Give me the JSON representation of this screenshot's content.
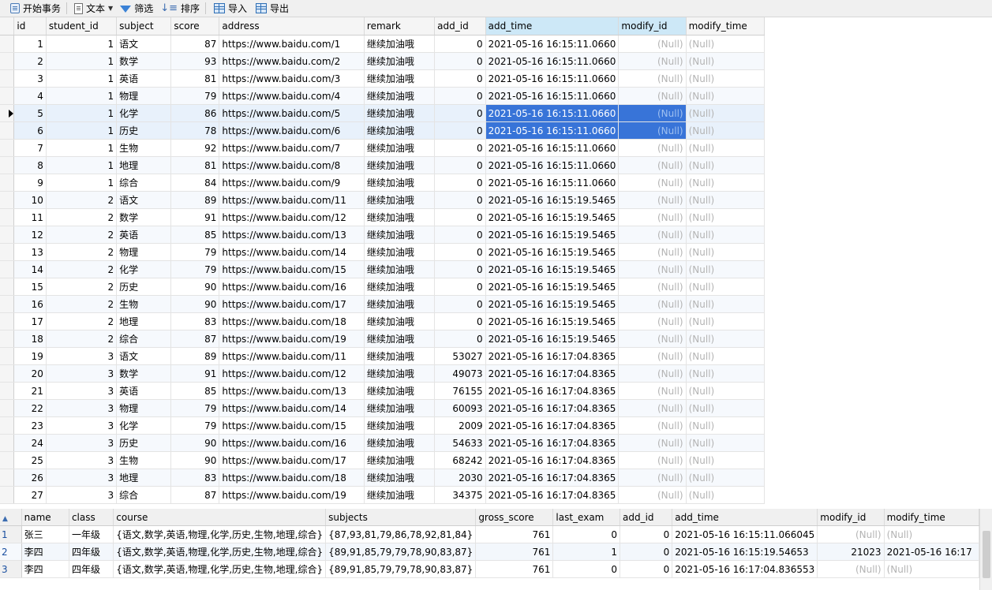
{
  "toolbar": {
    "begin_transaction": "开始事务",
    "text": "文本",
    "filter": "筛选",
    "sort": "排序",
    "import": "导入",
    "export": "导出"
  },
  "grid1": {
    "columns": [
      "id",
      "student_id",
      "subject",
      "score",
      "address",
      "remark",
      "add_id",
      "add_time",
      "modify_id",
      "modify_time"
    ],
    "rows": [
      [
        "1",
        "1",
        "语文",
        "87",
        "https://www.baidu.com/1",
        "继续加油哦",
        "0",
        "2021-05-16 16:15:11.0660",
        "(Null)",
        "(Null)"
      ],
      [
        "2",
        "1",
        "数学",
        "93",
        "https://www.baidu.com/2",
        "继续加油哦",
        "0",
        "2021-05-16 16:15:11.0660",
        "(Null)",
        "(Null)"
      ],
      [
        "3",
        "1",
        "英语",
        "81",
        "https://www.baidu.com/3",
        "继续加油哦",
        "0",
        "2021-05-16 16:15:11.0660",
        "(Null)",
        "(Null)"
      ],
      [
        "4",
        "1",
        "物理",
        "79",
        "https://www.baidu.com/4",
        "继续加油哦",
        "0",
        "2021-05-16 16:15:11.0660",
        "(Null)",
        "(Null)"
      ],
      [
        "5",
        "1",
        "化学",
        "86",
        "https://www.baidu.com/5",
        "继续加油哦",
        "0",
        "2021-05-16 16:15:11.0660",
        "(Null)",
        "(Null)"
      ],
      [
        "6",
        "1",
        "历史",
        "78",
        "https://www.baidu.com/6",
        "继续加油哦",
        "0",
        "2021-05-16 16:15:11.0660",
        "(Null)",
        "(Null)"
      ],
      [
        "7",
        "1",
        "生物",
        "92",
        "https://www.baidu.com/7",
        "继续加油哦",
        "0",
        "2021-05-16 16:15:11.0660",
        "(Null)",
        "(Null)"
      ],
      [
        "8",
        "1",
        "地理",
        "81",
        "https://www.baidu.com/8",
        "继续加油哦",
        "0",
        "2021-05-16 16:15:11.0660",
        "(Null)",
        "(Null)"
      ],
      [
        "9",
        "1",
        "综合",
        "84",
        "https://www.baidu.com/9",
        "继续加油哦",
        "0",
        "2021-05-16 16:15:11.0660",
        "(Null)",
        "(Null)"
      ],
      [
        "10",
        "2",
        "语文",
        "89",
        "https://www.baidu.com/11",
        "继续加油哦",
        "0",
        "2021-05-16 16:15:19.5465",
        "(Null)",
        "(Null)"
      ],
      [
        "11",
        "2",
        "数学",
        "91",
        "https://www.baidu.com/12",
        "继续加油哦",
        "0",
        "2021-05-16 16:15:19.5465",
        "(Null)",
        "(Null)"
      ],
      [
        "12",
        "2",
        "英语",
        "85",
        "https://www.baidu.com/13",
        "继续加油哦",
        "0",
        "2021-05-16 16:15:19.5465",
        "(Null)",
        "(Null)"
      ],
      [
        "13",
        "2",
        "物理",
        "79",
        "https://www.baidu.com/14",
        "继续加油哦",
        "0",
        "2021-05-16 16:15:19.5465",
        "(Null)",
        "(Null)"
      ],
      [
        "14",
        "2",
        "化学",
        "79",
        "https://www.baidu.com/15",
        "继续加油哦",
        "0",
        "2021-05-16 16:15:19.5465",
        "(Null)",
        "(Null)"
      ],
      [
        "15",
        "2",
        "历史",
        "90",
        "https://www.baidu.com/16",
        "继续加油哦",
        "0",
        "2021-05-16 16:15:19.5465",
        "(Null)",
        "(Null)"
      ],
      [
        "16",
        "2",
        "生物",
        "90",
        "https://www.baidu.com/17",
        "继续加油哦",
        "0",
        "2021-05-16 16:15:19.5465",
        "(Null)",
        "(Null)"
      ],
      [
        "17",
        "2",
        "地理",
        "83",
        "https://www.baidu.com/18",
        "继续加油哦",
        "0",
        "2021-05-16 16:15:19.5465",
        "(Null)",
        "(Null)"
      ],
      [
        "18",
        "2",
        "综合",
        "87",
        "https://www.baidu.com/19",
        "继续加油哦",
        "0",
        "2021-05-16 16:15:19.5465",
        "(Null)",
        "(Null)"
      ],
      [
        "19",
        "3",
        "语文",
        "89",
        "https://www.baidu.com/11",
        "继续加油哦",
        "53027",
        "2021-05-16 16:17:04.8365",
        "(Null)",
        "(Null)"
      ],
      [
        "20",
        "3",
        "数学",
        "91",
        "https://www.baidu.com/12",
        "继续加油哦",
        "49073",
        "2021-05-16 16:17:04.8365",
        "(Null)",
        "(Null)"
      ],
      [
        "21",
        "3",
        "英语",
        "85",
        "https://www.baidu.com/13",
        "继续加油哦",
        "76155",
        "2021-05-16 16:17:04.8365",
        "(Null)",
        "(Null)"
      ],
      [
        "22",
        "3",
        "物理",
        "79",
        "https://www.baidu.com/14",
        "继续加油哦",
        "60093",
        "2021-05-16 16:17:04.8365",
        "(Null)",
        "(Null)"
      ],
      [
        "23",
        "3",
        "化学",
        "79",
        "https://www.baidu.com/15",
        "继续加油哦",
        "2009",
        "2021-05-16 16:17:04.8365",
        "(Null)",
        "(Null)"
      ],
      [
        "24",
        "3",
        "历史",
        "90",
        "https://www.baidu.com/16",
        "继续加油哦",
        "54633",
        "2021-05-16 16:17:04.8365",
        "(Null)",
        "(Null)"
      ],
      [
        "25",
        "3",
        "生物",
        "90",
        "https://www.baidu.com/17",
        "继续加油哦",
        "68242",
        "2021-05-16 16:17:04.8365",
        "(Null)",
        "(Null)"
      ],
      [
        "26",
        "3",
        "地理",
        "83",
        "https://www.baidu.com/18",
        "继续加油哦",
        "2030",
        "2021-05-16 16:17:04.8365",
        "(Null)",
        "(Null)"
      ],
      [
        "27",
        "3",
        "综合",
        "87",
        "https://www.baidu.com/19",
        "继续加油哦",
        "34375",
        "2021-05-16 16:17:04.8365",
        "(Null)",
        "(Null)"
      ]
    ]
  },
  "grid2": {
    "columns": [
      "name",
      "class",
      "course",
      "subjects",
      "gross_score",
      "last_exam",
      "add_id",
      "add_time",
      "modify_id",
      "modify_time"
    ],
    "rows": [
      [
        "1",
        "张三",
        "一年级",
        "{语文,数学,英语,物理,化学,历史,生物,地理,综合}",
        "{87,93,81,79,86,78,92,81,84}",
        "761",
        "0",
        "0",
        "2021-05-16 16:15:11.066045",
        "(Null)",
        "(Null)"
      ],
      [
        "2",
        "李四",
        "四年级",
        "{语文,数学,英语,物理,化学,历史,生物,地理,综合}",
        "{89,91,85,79,79,78,90,83,87}",
        "761",
        "1",
        "0",
        "2021-05-16 16:15:19.54653",
        "21023",
        "2021-05-16 16:17"
      ],
      [
        "3",
        "李四",
        "四年级",
        "{语文,数学,英语,物理,化学,历史,生物,地理,综合}",
        "{89,91,85,79,79,78,90,83,87}",
        "761",
        "0",
        "0",
        "2021-05-16 16:17:04.836553",
        "(Null)",
        "(Null)"
      ]
    ]
  }
}
